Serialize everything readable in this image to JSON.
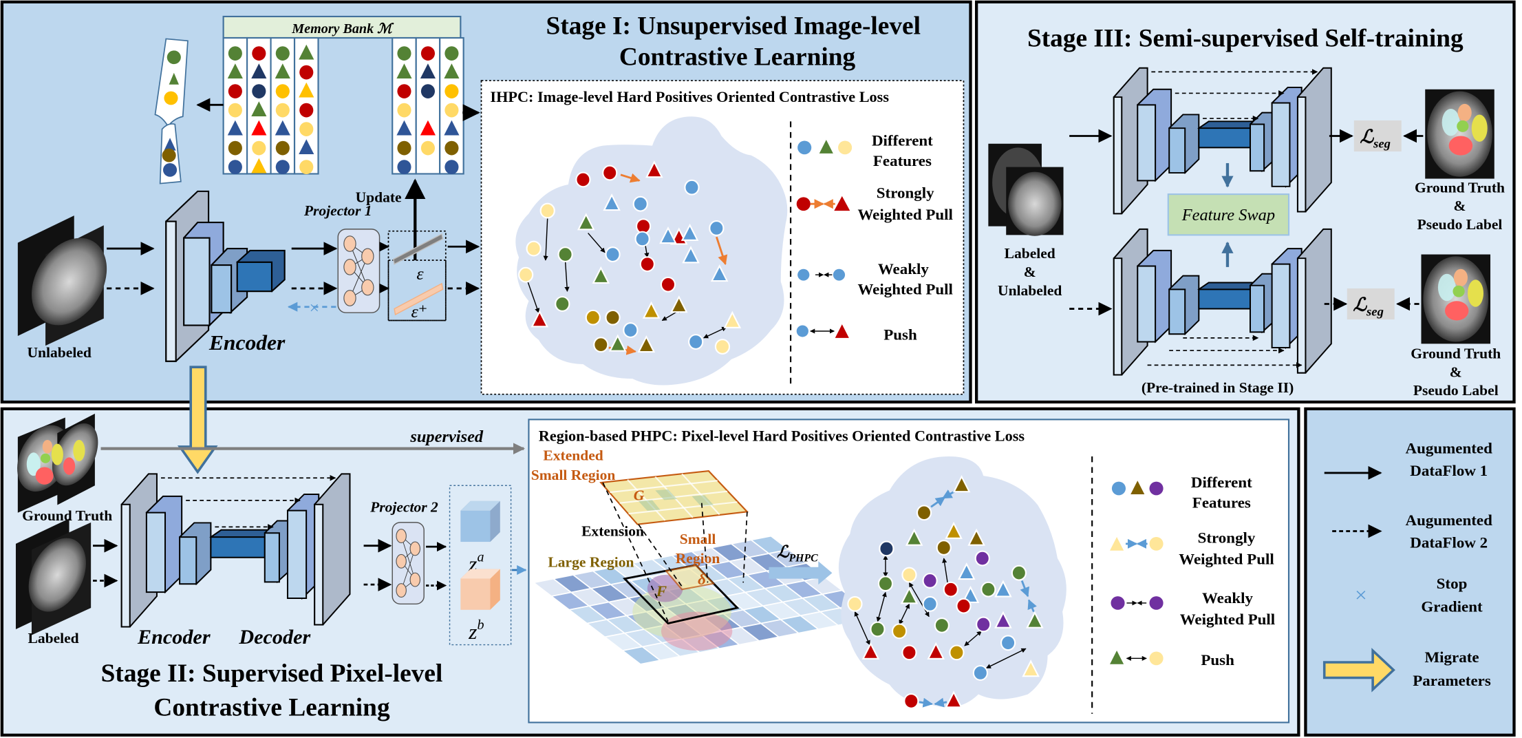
{
  "figure": {
    "stage1": {
      "title_line1": "Stage I: Unsupervised Image-level",
      "title_line2": "Contrastive Learning",
      "memory_bank_label": "Memory Bank ℳ",
      "update_label": "Update",
      "projector_label": "Projector 1",
      "encoder_label": "Encoder",
      "input_label": "Unlabeled",
      "embedding_symbol": "ε",
      "embedding_plus_symbol": "ε⁺",
      "ihpc_title": "IHPC: Image-level Hard Positives Oriented Contrastive Loss",
      "legend": [
        {
          "line1": "Different",
          "line2": "Features"
        },
        {
          "line1": "Strongly",
          "line2": "Weighted Pull"
        },
        {
          "line1": "Weakly",
          "line2": "Weighted Pull"
        },
        {
          "line1": "Push",
          "line2": ""
        }
      ]
    },
    "stage2": {
      "title_line1": "Stage II: Supervised Pixel-level",
      "title_line2": "Contrastive Learning",
      "supervised_label": "supervised",
      "ground_truth_label": "Ground Truth",
      "labeled_label": "Labeled",
      "encoder_label": "Encoder",
      "decoder_label": "Decoder",
      "projector_label": "Projector 2",
      "za_label": "z",
      "za_sup": "a",
      "zb_label": "z",
      "zb_sup": "b",
      "phpc_title": "Region-based PHPC: Pixel-level Hard Positives Oriented Contrastive Loss",
      "extended_small_region_line1": "Extended",
      "extended_small_region_line2": "Small Region",
      "extension_label": "Extension",
      "small_region_line1": "Small",
      "small_region_line2": "Region",
      "large_region_label": "Large Region",
      "g_symbol": "G",
      "f_symbol": "F",
      "delta_symbol": "δ",
      "loss_label": "ℒ",
      "loss_sub": "PHPC",
      "legend": [
        {
          "line1": "Different",
          "line2": "Features"
        },
        {
          "line1": "Strongly",
          "line2": "Weighted Pull"
        },
        {
          "line1": "Weakly",
          "line2": "Weighted Pull"
        },
        {
          "line1": "Push",
          "line2": ""
        }
      ]
    },
    "stage3": {
      "title": "Stage III: Semi-supervised Self-training",
      "input_line1": "Labeled",
      "input_line2": "&",
      "input_line3": "Unlabeled",
      "feature_swap_label": "Feature Swap",
      "pretrained_label": "(Pre-trained in Stage II)",
      "loss_label": "ℒ",
      "loss_sub": "seg",
      "gt_line1": "Ground Truth",
      "gt_line2": "&",
      "gt_line3": "Pseudo Label"
    },
    "legend_panel": {
      "items": [
        {
          "line1": "Augumented",
          "line2": "DataFlow 1",
          "icon": "solid-arrow-icon"
        },
        {
          "line1": "Augumented",
          "line2": "DataFlow  2",
          "icon": "dashed-arrow-icon"
        },
        {
          "line1": "Stop",
          "line2": "Gradient",
          "icon": "stop-gradient-icon"
        },
        {
          "line1": "Migrate",
          "line2": "Parameters",
          "icon": "migrate-arrow-icon"
        }
      ]
    },
    "colors": {
      "panel_dark": "#bdd7ee",
      "panel_light": "#deebf7",
      "feature_blue": "#5b9bd5",
      "feature_red": "#c00000",
      "feature_green": "#548235",
      "feature_yellow": "#ffe699",
      "feature_olive": "#7f6000",
      "feature_purple": "#7030a0",
      "feature_gold": "#bf9000",
      "migrate_yellow": "#ffd966",
      "pull_orange": "#ed7d31"
    }
  }
}
